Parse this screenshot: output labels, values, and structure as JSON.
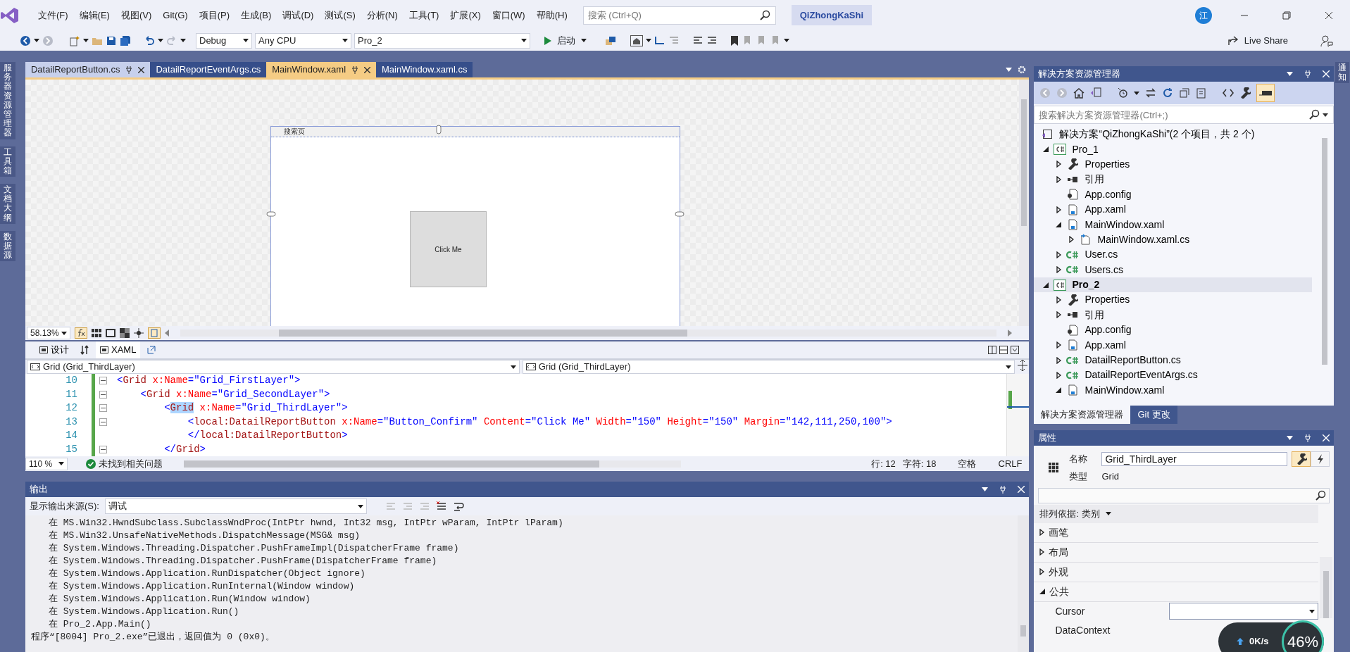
{
  "menu": [
    "文件(F)",
    "编辑(E)",
    "视图(V)",
    "Git(G)",
    "项目(P)",
    "生成(B)",
    "调试(D)",
    "测试(S)",
    "分析(N)",
    "工具(T)",
    "扩展(X)",
    "窗口(W)",
    "帮助(H)"
  ],
  "search": {
    "placeholder": "搜索 (Ctrl+Q)"
  },
  "solution_name": "QiZhongKaShi",
  "avatar": "江",
  "toolbar": {
    "configuration": "Debug",
    "platform": "Any CPU",
    "startup_project": "Pro_2",
    "start_button": "启动",
    "live_share": "Live Share"
  },
  "side_tabs": [
    "服务器资源管理器",
    "工具箱",
    "文档大纲",
    "数据源"
  ],
  "doc_tabs": [
    {
      "label": "DatailReportButton.cs",
      "selected": false,
      "pinned": true
    },
    {
      "label": "DatailReportEventArgs.cs",
      "selected": false,
      "pinned": false
    },
    {
      "label": "MainWindow.xaml",
      "selected": true,
      "pinned": true
    },
    {
      "label": "MainWindow.xaml.cs",
      "selected": false,
      "pinned": false
    }
  ],
  "designer": {
    "window_title": "搜索页",
    "button_label": "Click Me",
    "zoom": "58.13%"
  },
  "view_tabs": [
    {
      "label": "设计",
      "selected": false
    },
    {
      "label": "XAML",
      "selected": true
    }
  ],
  "nav_bar": [
    "Grid (Grid_ThirdLayer)",
    "Grid (Grid_ThirdLayer)"
  ],
  "code_lines": [
    {
      "number": "10",
      "foldable": true,
      "tokens": [
        {
          "kind": "punct",
          "text": "<"
        },
        {
          "kind": "elem",
          "text": "Grid"
        },
        {
          "kind": "attr",
          "text": " x:Name"
        },
        {
          "kind": "punct",
          "text": "=\""
        },
        {
          "kind": "val",
          "text": "Grid_FirstLayer"
        },
        {
          "kind": "punct",
          "text": "\">"
        }
      ]
    },
    {
      "number": "11",
      "foldable": true,
      "tokens": [
        {
          "kind": "punct",
          "text": "    <"
        },
        {
          "kind": "elem",
          "text": "Grid"
        },
        {
          "kind": "attr",
          "text": " x:Name"
        },
        {
          "kind": "punct",
          "text": "=\""
        },
        {
          "kind": "val",
          "text": "Grid_SecondLayer"
        },
        {
          "kind": "punct",
          "text": "\">"
        }
      ]
    },
    {
      "number": "12",
      "foldable": true,
      "tokens": [
        {
          "kind": "punct",
          "text": "        <"
        },
        {
          "kind": "selection",
          "text": "Grid"
        },
        {
          "kind": "attr",
          "text": " x:Name"
        },
        {
          "kind": "punct",
          "text": "=\""
        },
        {
          "kind": "val",
          "text": "Grid_ThirdLayer"
        },
        {
          "kind": "punct",
          "text": "\">"
        }
      ]
    },
    {
      "number": "13",
      "foldable": true,
      "tokens": [
        {
          "kind": "punct",
          "text": "            <"
        },
        {
          "kind": "elem",
          "text": "local:DatailReportButton"
        },
        {
          "kind": "attr",
          "text": " x:Name"
        },
        {
          "kind": "punct",
          "text": "=\""
        },
        {
          "kind": "val",
          "text": "Button_Confirm"
        },
        {
          "kind": "punct",
          "text": "\""
        },
        {
          "kind": "attr",
          "text": " Content"
        },
        {
          "kind": "punct",
          "text": "=\""
        },
        {
          "kind": "val",
          "text": "Click Me"
        },
        {
          "kind": "punct",
          "text": "\""
        },
        {
          "kind": "attr",
          "text": " Width"
        },
        {
          "kind": "punct",
          "text": "=\""
        },
        {
          "kind": "val",
          "text": "150"
        },
        {
          "kind": "punct",
          "text": "\""
        },
        {
          "kind": "attr",
          "text": " Height"
        },
        {
          "kind": "punct",
          "text": "=\""
        },
        {
          "kind": "val",
          "text": "150"
        },
        {
          "kind": "punct",
          "text": "\""
        },
        {
          "kind": "attr",
          "text": " Margin"
        },
        {
          "kind": "punct",
          "text": "=\""
        },
        {
          "kind": "val",
          "text": "142,111,250,100"
        },
        {
          "kind": "punct",
          "text": "\">"
        }
      ]
    },
    {
      "number": "14",
      "foldable": false,
      "tokens": [
        {
          "kind": "punct",
          "text": "            </"
        },
        {
          "kind": "elem",
          "text": "local:DatailReportButton"
        },
        {
          "kind": "punct",
          "text": ">"
        }
      ]
    },
    {
      "number": "15",
      "foldable": true,
      "tokens": [
        {
          "kind": "punct",
          "text": "        </"
        },
        {
          "kind": "elem",
          "text": "Grid"
        },
        {
          "kind": "punct",
          "text": ">"
        }
      ]
    }
  ],
  "status": {
    "zoom": "110 %",
    "issues": "未找到相关问题",
    "line": "行: 12",
    "char": "字符: 18",
    "indent": "空格",
    "eol": "CRLF"
  },
  "output": {
    "title": "输出",
    "source_label": "显示输出来源(S):",
    "source": "调试",
    "lines": [
      {
        "kind": "frame",
        "text": "在 MS.Win32.HwndSubclass.SubclassWndProc(IntPtr hwnd, Int32 msg, IntPtr wParam, IntPtr lParam)"
      },
      {
        "kind": "frame",
        "text": "在 MS.Win32.UnsafeNativeMethods.DispatchMessage(MSG& msg)"
      },
      {
        "kind": "frame",
        "text": "在 System.Windows.Threading.Dispatcher.PushFrameImpl(DispatcherFrame frame)"
      },
      {
        "kind": "frame",
        "text": "在 System.Windows.Threading.Dispatcher.PushFrame(DispatcherFrame frame)"
      },
      {
        "kind": "frame",
        "text": "在 System.Windows.Application.RunDispatcher(Object ignore)"
      },
      {
        "kind": "frame",
        "text": "在 System.Windows.Application.RunInternal(Window window)"
      },
      {
        "kind": "frame",
        "text": "在 System.Windows.Application.Run(Window window)"
      },
      {
        "kind": "frame",
        "text": "在 System.Windows.Application.Run()"
      },
      {
        "kind": "frame",
        "text": "在 Pro_2.App.Main()"
      },
      {
        "kind": "message",
        "text": "程序“[8004] Pro_2.exe”已退出，返回值为 0 (0x0)。"
      }
    ]
  },
  "solution_explorer": {
    "title": "解决方案资源管理器",
    "search_placeholder": "搜索解决方案资源管理器(Ctrl+;)",
    "tree": [
      {
        "label": "解决方案“QiZhongKaShi”(2 个项目，共 2 个)",
        "kind": "solution",
        "selected": false,
        "children": [
          {
            "label": "Pro_1",
            "kind": "project",
            "expandable": true,
            "expanded": true,
            "selected": false,
            "children": [
              {
                "label": "Properties",
                "kind": "wrench",
                "expandable": true,
                "expanded": false,
                "selected": false
              },
              {
                "label": "引用",
                "kind": "reference",
                "expandable": true,
                "expanded": false,
                "selected": false
              },
              {
                "label": "App.config",
                "kind": "config",
                "expandable": false,
                "selected": false
              },
              {
                "label": "App.xaml",
                "kind": "xaml",
                "expandable": true,
                "expanded": false,
                "selected": false
              },
              {
                "label": "MainWindow.xaml",
                "kind": "xaml",
                "expandable": true,
                "expanded": true,
                "selected": false,
                "children": [
                  {
                    "label": "MainWindow.xaml.cs",
                    "kind": "codebehind",
                    "expandable": true,
                    "expanded": false,
                    "selected": false
                  }
                ]
              },
              {
                "label": "User.cs",
                "kind": "cs",
                "expandable": true,
                "expanded": false,
                "selected": false
              },
              {
                "label": "Users.cs",
                "kind": "cs",
                "expandable": true,
                "expanded": false,
                "selected": false
              }
            ]
          },
          {
            "label": "Pro_2",
            "kind": "project",
            "expandable": true,
            "expanded": true,
            "selected": true,
            "children": [
              {
                "label": "Properties",
                "kind": "wrench",
                "expandable": true,
                "expanded": false,
                "selected": false
              },
              {
                "label": "引用",
                "kind": "reference",
                "expandable": true,
                "expanded": false,
                "selected": false
              },
              {
                "label": "App.config",
                "kind": "config",
                "expandable": false,
                "selected": false
              },
              {
                "label": "App.xaml",
                "kind": "xaml",
                "expandable": true,
                "expanded": false,
                "selected": false
              },
              {
                "label": "DatailReportButton.cs",
                "kind": "cs",
                "expandable": true,
                "expanded": false,
                "selected": false
              },
              {
                "label": "DatailReportEventArgs.cs",
                "kind": "cs",
                "expandable": true,
                "expanded": false,
                "selected": false
              },
              {
                "label": "MainWindow.xaml",
                "kind": "xaml",
                "expandable": true,
                "expanded": true,
                "selected": false
              }
            ]
          }
        ]
      }
    ],
    "tabs": [
      {
        "label": "解决方案资源管理器",
        "selected": true
      },
      {
        "label": "Git 更改",
        "selected": false
      }
    ]
  },
  "properties": {
    "title": "属性",
    "name_label": "名称",
    "name_value": "Grid_ThirdLayer",
    "type_label": "类型",
    "type_value": "Grid",
    "sort": "排列依据: 类别",
    "categories": [
      {
        "label": "画笔",
        "expanded": false
      },
      {
        "label": "布局",
        "expanded": false
      },
      {
        "label": "外观",
        "expanded": false
      },
      {
        "label": "公共",
        "expanded": true,
        "children": [
          {
            "label": "Cursor",
            "kind": "dropdown"
          },
          {
            "label": "DataContext",
            "kind": "text"
          }
        ]
      }
    ]
  },
  "right_tabs": [
    "通知"
  ],
  "network_widget": {
    "speed": "0K/s",
    "percent": "46%"
  }
}
